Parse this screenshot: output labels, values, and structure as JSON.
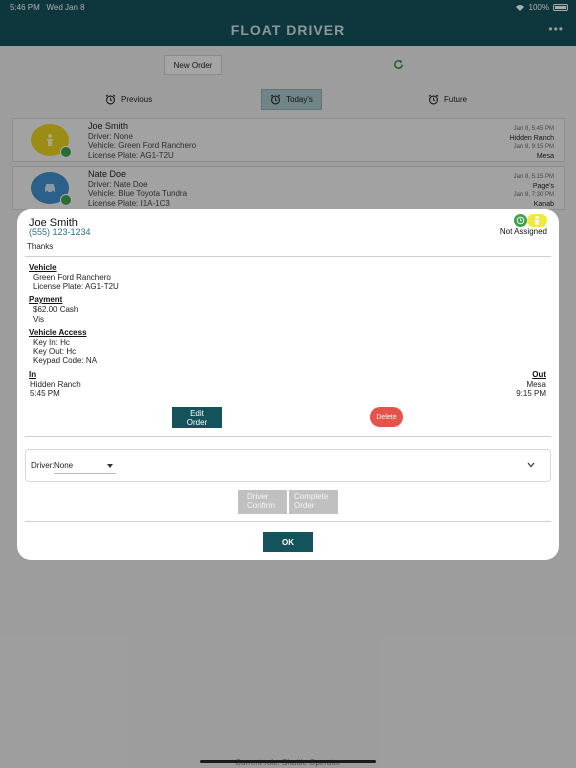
{
  "status_bar": {
    "time": "5:46 PM",
    "date": "Wed Jan 8",
    "battery": "100%"
  },
  "header": {
    "title": "FLOAT DRIVER"
  },
  "toolbar": {
    "new_order_label": "New Order"
  },
  "tabs": [
    {
      "label": "Previous"
    },
    {
      "label": "Today's"
    },
    {
      "label": "Future"
    }
  ],
  "orders": [
    {
      "name": "Joe Smith",
      "driver": "Driver: None",
      "vehicle": "Vehicle: Green Ford Ranchero",
      "plate": "License Plate: AG1-T2U",
      "in_date": "Jan 8, 5:45 PM",
      "in_place": "Hidden Ranch",
      "out_date": "Jan 8, 9:15 PM",
      "out_place": "Mesa",
      "avatar_color": "#e8d31f"
    },
    {
      "name": "Nate Doe",
      "driver": "Driver: Nate Doe",
      "vehicle": "Vehicle: Blue Toyota Tundra",
      "plate": "License Plate: I1A-1C3",
      "in_date": "Jan 8, 5:15 PM",
      "in_place": "Page's",
      "out_date": "Jan 8, 7:30 PM",
      "out_place": "Kanab",
      "avatar_color": "#3f8fce"
    }
  ],
  "modal": {
    "name": "Joe Smith",
    "phone": "(555) 123-1234",
    "status": "Not Assigned",
    "note": "Thanks",
    "vehicle_title": "Vehicle",
    "vehicle_desc": "Green Ford Ranchero",
    "vehicle_plate": "License Plate: AG1-T2U",
    "payment_title": "Payment",
    "payment_amount": "$62.00 Cash",
    "payment_note": "Vis",
    "access_title": "Vehicle Access",
    "key_in": "Key In: Hc",
    "key_out": "Key Out: Hc",
    "keypad": "Keypad Code: NA",
    "in_title": "In",
    "in_place": "Hidden Ranch",
    "in_time": "5:45 PM",
    "out_title": "Out",
    "out_place": "Mesa",
    "out_time": "9:15 PM",
    "edit_label_1": "Edit",
    "edit_label_2": "Order",
    "delete_label": "Delete",
    "driver_label": "Driver:",
    "driver_value": "None",
    "driver_confirm_1": "Driver",
    "driver_confirm_2": "Confirm",
    "complete_1": "Complete",
    "complete_2": "Order",
    "ok_label": "OK"
  },
  "footer": {
    "text": "Current role: Shuttle Operator"
  },
  "colors": {
    "primary": "#15535c",
    "danger": "#e5534b",
    "success": "#3fa34d",
    "warning": "#f1e93a",
    "link": "#2a6f86"
  }
}
